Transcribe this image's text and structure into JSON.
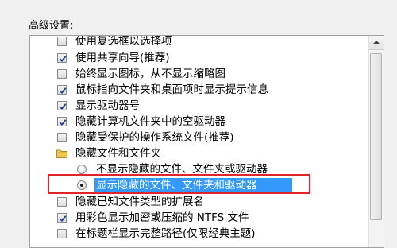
{
  "advanced": {
    "title": "高级设置:",
    "items": [
      {
        "label": "使用复选框以选择项",
        "type": "checkbox",
        "checked": false
      },
      {
        "label": "使用共享向导(推荐)",
        "type": "checkbox",
        "checked": true
      },
      {
        "label": "始终显示图标，从不显示缩略图",
        "type": "checkbox",
        "checked": false
      },
      {
        "label": "鼠标指向文件夹和桌面项时显示提示信息",
        "type": "checkbox",
        "checked": true
      },
      {
        "label": "显示驱动器号",
        "type": "checkbox",
        "checked": true
      },
      {
        "label": "隐藏计算机文件夹中的空驱动器",
        "type": "checkbox",
        "checked": true
      },
      {
        "label": "隐藏受保护的操作系统文件(推荐)",
        "type": "checkbox",
        "checked": false
      },
      {
        "label": "隐藏文件和文件夹",
        "type": "folder"
      },
      {
        "label": "不显示隐藏的文件、文件夹或驱动器",
        "type": "radio",
        "checked": false
      },
      {
        "label": "显示隐藏的文件、文件夹和驱动器",
        "type": "radio",
        "checked": true,
        "selected": true
      },
      {
        "label": "隐藏已知文件类型的扩展名",
        "type": "checkbox",
        "checked": false
      },
      {
        "label": "用彩色显示加密或压缩的 NTFS 文件",
        "type": "checkbox",
        "checked": true
      },
      {
        "label": "在标题栏显示完整路径(仅限经典主题)",
        "type": "checkbox",
        "checked": false
      }
    ]
  },
  "colors": {
    "selection": "#3399ff",
    "annotation_box": "#e0242a"
  }
}
